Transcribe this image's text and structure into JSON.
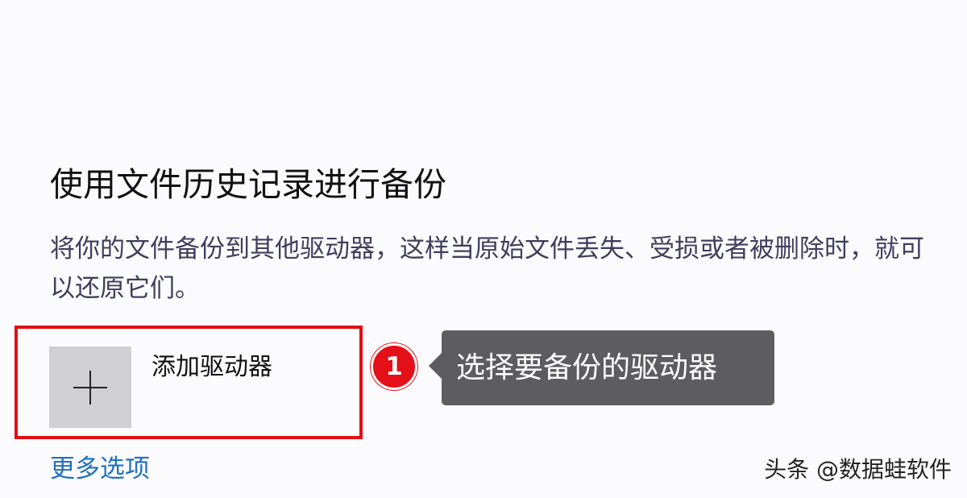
{
  "section": {
    "title": "使用文件历史记录进行备份",
    "description": "将你的文件备份到其他驱动器，这样当原始文件丢失、受损或者被删除时，就可以还原它们。"
  },
  "add_drive": {
    "icon": "plus-icon",
    "label": "添加驱动器"
  },
  "annotation": {
    "step_number": "1",
    "tooltip_text": "选择要备份的驱动器",
    "highlight_color": "#e10f13",
    "badge_color": "#e50f18",
    "tooltip_bg_color": "#5d5d61"
  },
  "more_options": {
    "label": "更多选项",
    "color": "#1f71bd"
  },
  "watermark": {
    "text": "头条 @数据蛙软件"
  }
}
